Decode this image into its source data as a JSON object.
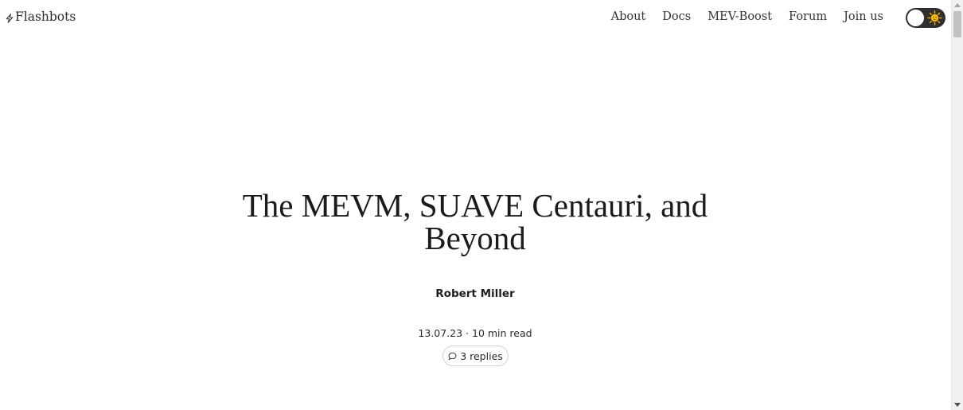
{
  "header": {
    "logo_text": "Flashbots",
    "nav": [
      {
        "label": "About"
      },
      {
        "label": "Docs"
      },
      {
        "label": "MEV-Boost"
      },
      {
        "label": "Forum"
      },
      {
        "label": "Join us"
      }
    ],
    "theme_toggle": {
      "state": "light",
      "icon": "sun-icon"
    }
  },
  "article": {
    "title": "The MEVM, SUAVE Centauri, and Beyond",
    "author": "Robert Miller",
    "meta": "13.07.23 · 10 min read",
    "replies_label": "3 replies"
  },
  "colors": {
    "toggle_track": "#2f2f2f",
    "sun": "#f5b800",
    "text": "#222222"
  }
}
